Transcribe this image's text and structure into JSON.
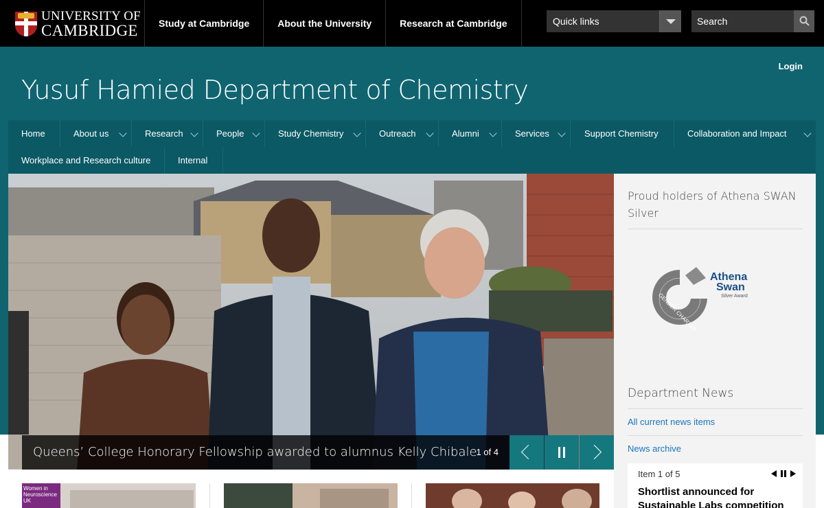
{
  "university": {
    "line1": "UNIVERSITY OF",
    "line2": "CAMBRIDGE"
  },
  "top_nav": [
    "Study at Cambridge",
    "About the University",
    "Research at Cambridge"
  ],
  "quick_links": "Quick links",
  "search": {
    "placeholder": "Search"
  },
  "login": "Login",
  "department_title": "Yusuf Hamied Department of Chemistry",
  "main_nav": {
    "row1": [
      "Home",
      "About us",
      "Research",
      "People",
      "Study Chemistry",
      "Outreach",
      "Alumni",
      "Services",
      "Support Chemistry",
      "Collaboration and Impact"
    ],
    "row2": [
      "Workplace and Research culture",
      "Internal"
    ]
  },
  "carousel": {
    "caption": "Queens’ College Honorary Fellowship awarded to alumnus Kelly Chibale",
    "count": "1 of 4"
  },
  "sidebar": {
    "athena_heading": "Proud holders of Athena SWAN Silver",
    "athena_logo": {
      "name": "Athena Swan",
      "name1": "Athena",
      "name2": "Swan",
      "award": "Silver Award",
      "ring_text": "GENDER CHARTER"
    },
    "news_heading": "Department News",
    "links": [
      "All current news items",
      "News archive"
    ],
    "news_item": {
      "counter": "Item 1 of 5",
      "title": "Shortlist announced for Sustainable Labs competition"
    }
  },
  "thumbnails": {
    "badge": "Women in Neuroscience UK"
  },
  "colors": {
    "teal": "#106470",
    "nav": "#0b5965",
    "link": "#1a75bc",
    "control": "#15787f"
  }
}
